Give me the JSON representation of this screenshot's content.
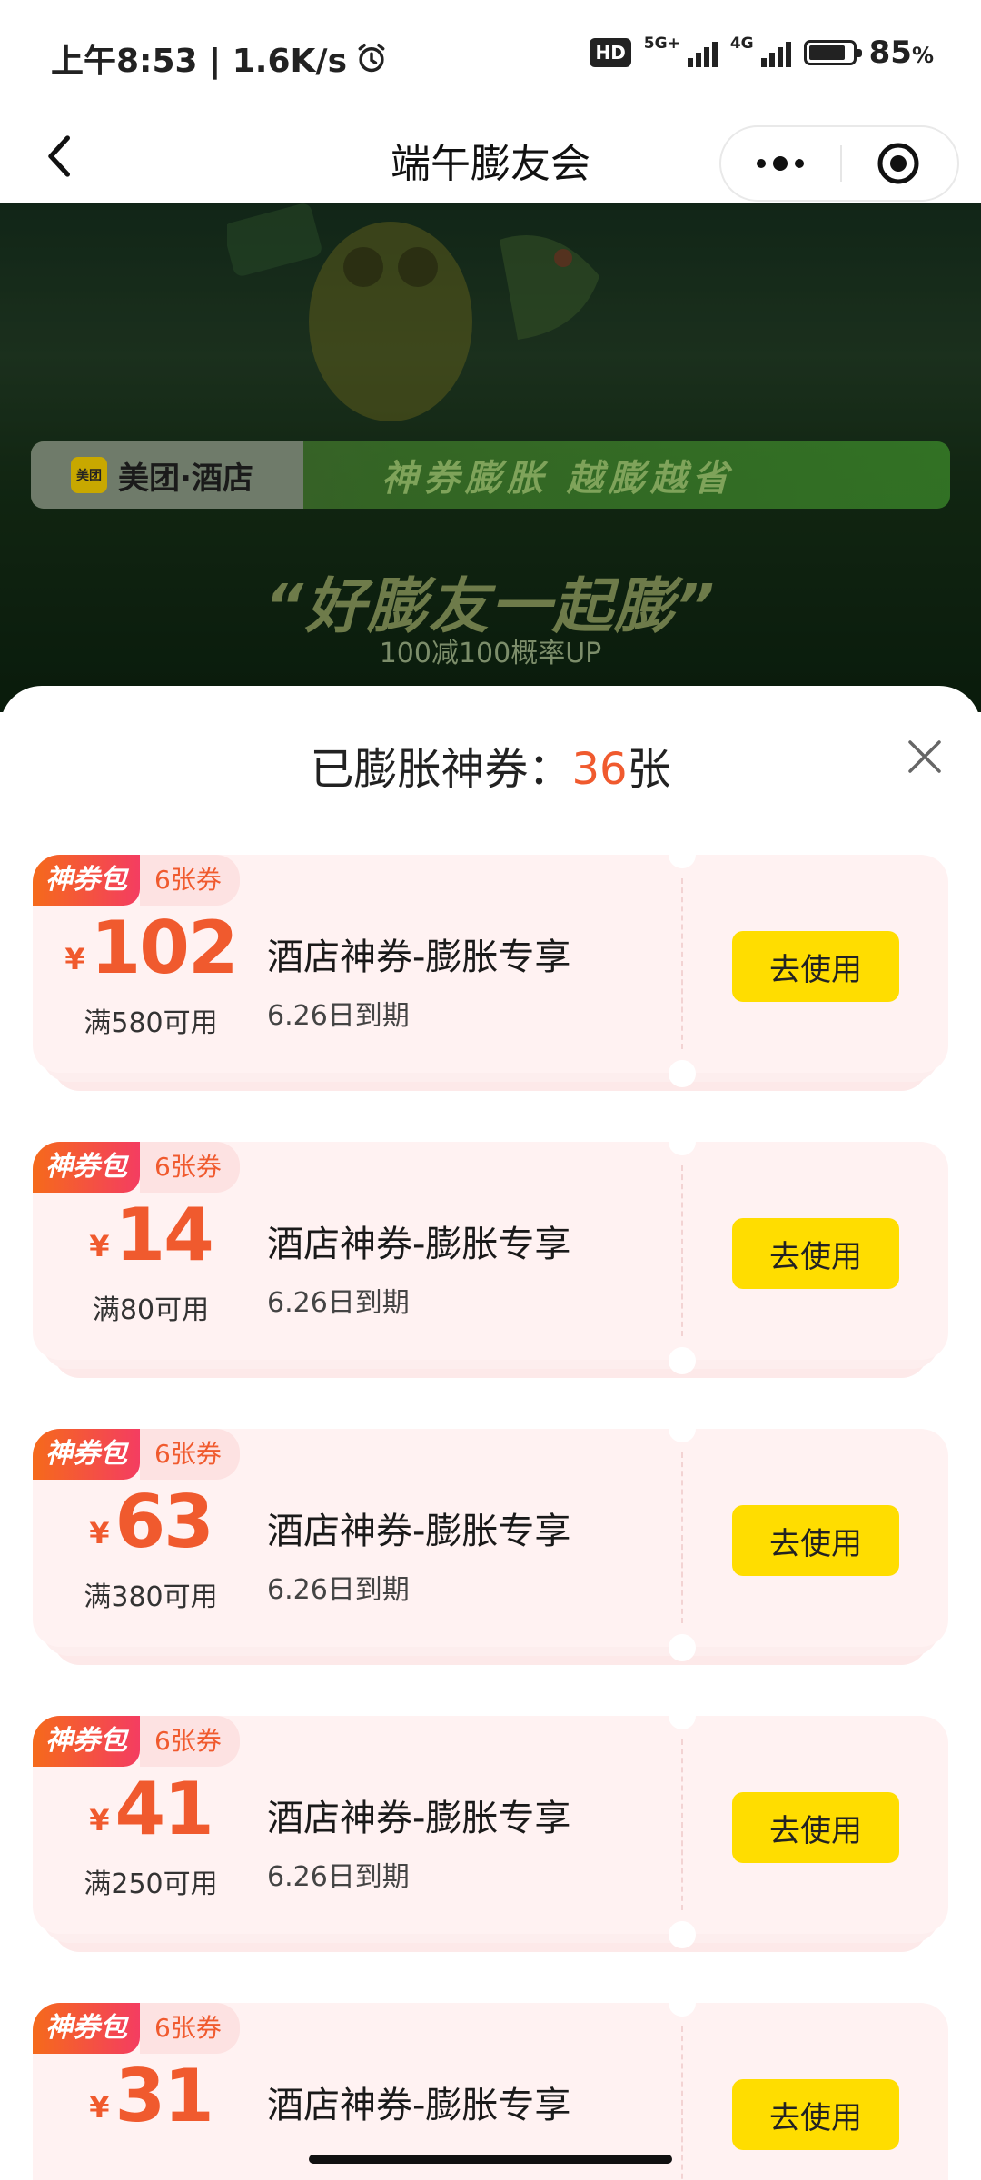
{
  "status_bar": {
    "time": "上午8:53 | 1.6K/s",
    "hd": "HD",
    "net_5g": "5G+",
    "net_4g": "4G",
    "battery": "85",
    "battery_pct": "%",
    "battery_level": 0.85
  },
  "nav": {
    "title": "端午膨友会"
  },
  "banner": {
    "brand": "美团·酒店",
    "brand_logo": "美团",
    "slogan": "神券膨胀 越膨越省",
    "headline": "“好膨友一起膨”",
    "subline": "100减100概率UP"
  },
  "sheet": {
    "title_prefix": "已膨胀神券：",
    "count": "36",
    "title_suffix": "张"
  },
  "coupons": [
    {
      "tag": "神券包",
      "count": "6张券",
      "yen": "¥",
      "amount": "102",
      "condition": "满580可用",
      "title": "酒店神券-膨胀专享",
      "expiry": "6.26日到期",
      "button": "去使用"
    },
    {
      "tag": "神券包",
      "count": "6张券",
      "yen": "¥",
      "amount": "14",
      "condition": "满80可用",
      "title": "酒店神券-膨胀专享",
      "expiry": "6.26日到期",
      "button": "去使用"
    },
    {
      "tag": "神券包",
      "count": "6张券",
      "yen": "¥",
      "amount": "63",
      "condition": "满380可用",
      "title": "酒店神券-膨胀专享",
      "expiry": "6.26日到期",
      "button": "去使用"
    },
    {
      "tag": "神券包",
      "count": "6张券",
      "yen": "¥",
      "amount": "41",
      "condition": "满250可用",
      "title": "酒店神券-膨胀专享",
      "expiry": "6.26日到期",
      "button": "去使用"
    },
    {
      "tag": "神券包",
      "count": "6张券",
      "yen": "¥",
      "amount": "31",
      "condition": "",
      "title": "酒店神券-膨胀专享",
      "expiry": "",
      "button": "去使用"
    }
  ],
  "colors": {
    "accent": "#f05a2e",
    "button": "#ffdd00",
    "coupon_bg": "#fff2f2"
  },
  "icons": {
    "alarm": "alarm-clock-icon",
    "back": "chevron-left-icon",
    "more": "more-dots-icon",
    "close_app": "target-circle-icon",
    "close_sheet": "close-x-icon"
  }
}
